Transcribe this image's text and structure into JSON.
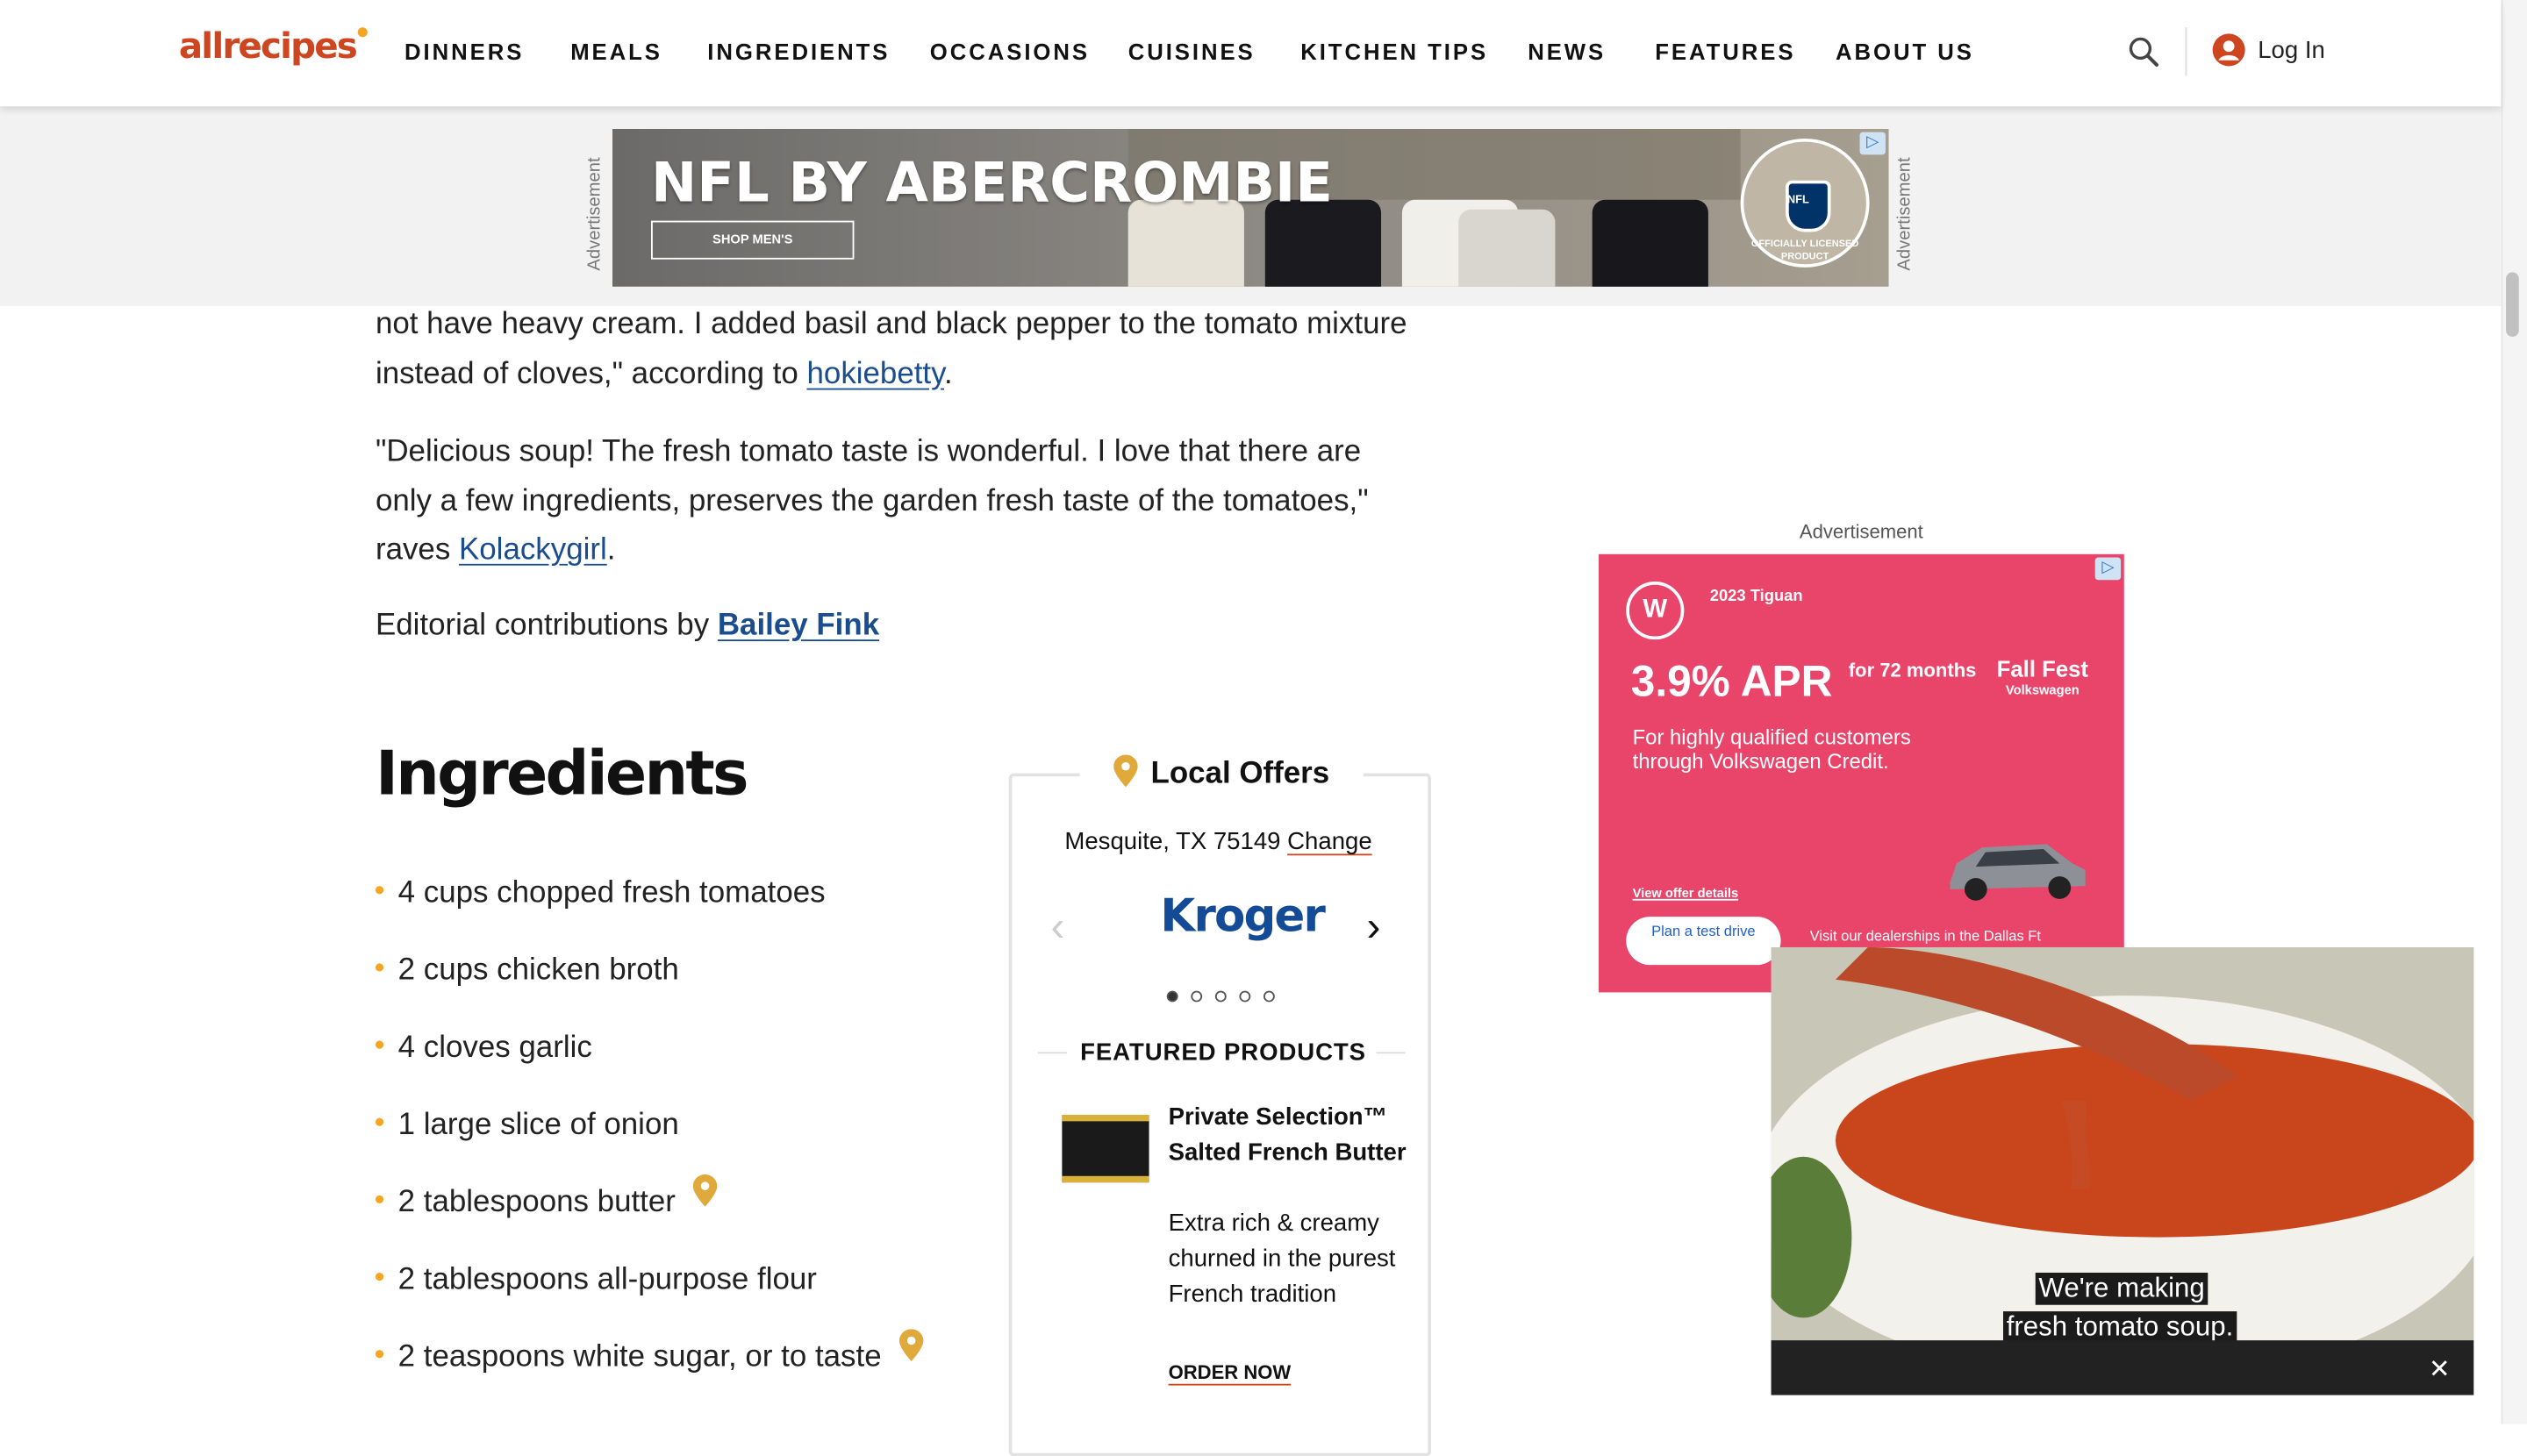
{
  "header": {
    "logo_text": "allrecipes",
    "nav": [
      "DINNERS",
      "MEALS",
      "INGREDIENTS",
      "OCCASIONS",
      "CUISINES",
      "KITCHEN TIPS",
      "NEWS",
      "FEATURES",
      "ABOUT US"
    ],
    "login_label": "Log In",
    "search_icon": "search-icon",
    "avatar_icon": "user-avatar-icon"
  },
  "top_ad": {
    "side_label": "Advertisement",
    "headline": "NFL BY ABERCROMBIE",
    "cta": "SHOP MEN'S",
    "badge_text": "OFFICIALLY LICENSED PRODUCT",
    "badge_logo": "NFL"
  },
  "article": {
    "review1_line1": "not have heavy cream. I added basil and black pepper to the tomato mixture",
    "review1_line2_prefix": "instead of cloves,\" according to ",
    "review1_author": "hokiebetty",
    "review1_suffix": ".",
    "review2_text": "\"Delicious soup! The fresh tomato taste is wonderful. I love that there are only a few ingredients, preserves the garden fresh taste of the tomatoes,\" raves ",
    "review2_author": "Kolackygirl",
    "review2_suffix": ".",
    "editorial_prefix": "Editorial contributions by ",
    "editorial_author": "Bailey Fink"
  },
  "ingredients": {
    "heading": "Ingredients",
    "items": [
      {
        "text": "4 cups chopped fresh tomatoes",
        "pin": false
      },
      {
        "text": "2 cups chicken broth",
        "pin": false
      },
      {
        "text": "4 cloves garlic",
        "pin": false
      },
      {
        "text": "1 large slice of onion",
        "pin": false
      },
      {
        "text": "2 tablespoons butter",
        "pin": true
      },
      {
        "text": "2 tablespoons all-purpose flour",
        "pin": false
      },
      {
        "text": "2 teaspoons white sugar, or to taste",
        "pin": true
      }
    ]
  },
  "local_offers": {
    "title": "Local Offers",
    "location": "Mesquite, TX 75149",
    "change_label": "Change",
    "store": "Kroger",
    "carousel_total": 5,
    "carousel_active": 1,
    "featured_title": "FEATURED PRODUCTS",
    "product_name": "Private Selection™ Salted French Butter",
    "product_desc": "Extra rich & creamy churned in the purest French tradition",
    "order_label": "ORDER NOW"
  },
  "side_ad": {
    "label": "Advertisement",
    "model": "2023 Tiguan",
    "apr": "3.9% APR",
    "months": "for 72 months",
    "fall_fest": "Fall Fest",
    "brand": "Volkswagen",
    "qualify": "For highly qualified customers through Volkswagen Credit.",
    "offer_link": "View offer details",
    "button": "Plan a test drive",
    "visit": "Visit our dealerships in the Dallas Ft"
  },
  "video": {
    "caption_line1": "We're making",
    "caption_line2": "fresh tomato soup.",
    "close_label": "✕"
  },
  "colors": {
    "brand": "#ce4620",
    "accent": "#f4a523",
    "link": "#1a4d8f",
    "vw_ad_bg": "#e9456b"
  }
}
